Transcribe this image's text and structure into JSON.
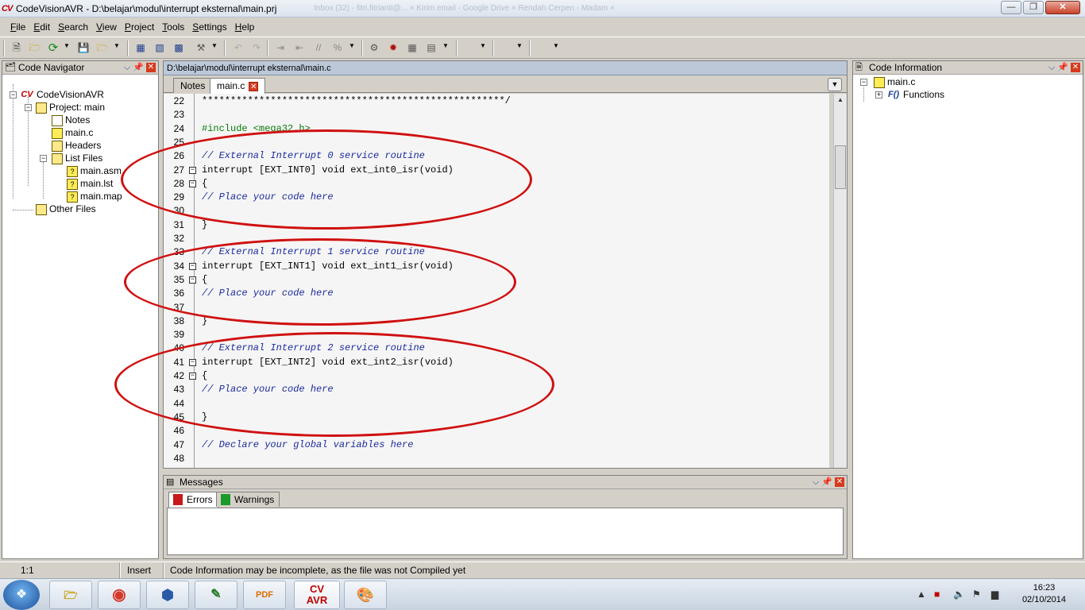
{
  "window": {
    "title": "CodeVisionAVR - D:\\belajar\\modul\\interrupt eksternal\\main.prj",
    "logo": "CV",
    "background_tabs": "Inbox (32) - fitri.fitrianti@...   ×   Kirim email - Google Drive   ×   Rendah Cerpen - Madam   ×"
  },
  "menu": [
    "File",
    "Edit",
    "Search",
    "View",
    "Project",
    "Tools",
    "Settings",
    "Help"
  ],
  "code_navigator": {
    "title": "Code Navigator",
    "root": "CodeVisionAVR",
    "project": "Project: main",
    "items": [
      "Notes",
      "main.c",
      "Headers",
      "List Files"
    ],
    "list_files": [
      "main.asm",
      "main.lst",
      "main.map"
    ],
    "other": "Other Files"
  },
  "editor": {
    "path": "D:\\belajar\\modul\\interrupt eksternal\\main.c",
    "tabs": [
      "Notes",
      "main.c"
    ],
    "lines": [
      {
        "n": "22",
        "t": "*****************************************************/"
      },
      {
        "n": "23",
        "t": ""
      },
      {
        "n": "24",
        "t": "#include <mega32.h>"
      },
      {
        "n": "25",
        "t": ""
      },
      {
        "n": "26",
        "t": "// External Interrupt 0 service routine"
      },
      {
        "n": "27",
        "t": "interrupt [EXT_INT0] void ext_int0_isr(void)"
      },
      {
        "n": "28",
        "t": "{"
      },
      {
        "n": "29",
        "t": "// Place your code here"
      },
      {
        "n": "30",
        "t": ""
      },
      {
        "n": "31",
        "t": "}"
      },
      {
        "n": "32",
        "t": ""
      },
      {
        "n": "33",
        "t": "// External Interrupt 1 service routine"
      },
      {
        "n": "34",
        "t": "interrupt [EXT_INT1] void ext_int1_isr(void)"
      },
      {
        "n": "35",
        "t": "{"
      },
      {
        "n": "36",
        "t": "// Place your code here"
      },
      {
        "n": "37",
        "t": ""
      },
      {
        "n": "38",
        "t": "}"
      },
      {
        "n": "39",
        "t": ""
      },
      {
        "n": "40",
        "t": "// External Interrupt 2 service routine"
      },
      {
        "n": "41",
        "t": "interrupt [EXT_INT2] void ext_int2_isr(void)"
      },
      {
        "n": "42",
        "t": "{"
      },
      {
        "n": "43",
        "t": "// Place your code here"
      },
      {
        "n": "44",
        "t": ""
      },
      {
        "n": "45",
        "t": "}"
      },
      {
        "n": "46",
        "t": ""
      },
      {
        "n": "47",
        "t": "// Declare your global variables here"
      },
      {
        "n": "48",
        "t": ""
      }
    ]
  },
  "messages": {
    "title": "Messages",
    "tabs": [
      "Errors",
      "Warnings"
    ]
  },
  "code_information": {
    "title": "Code Information",
    "file": "main.c",
    "functions": "Functions",
    "fn_icon": "F()"
  },
  "status": {
    "position": "1:1",
    "mode": "Insert",
    "message": "Code Information may be incomplete, as the file was not Compiled yet"
  },
  "taskbar": {
    "apps": [
      "explorer",
      "chrome",
      "virtualbox",
      "notepad",
      "pdf",
      "CV AVR",
      "paint"
    ],
    "cv_label": "CV",
    "cv_label2": "AVR",
    "pdf_label": "PDF",
    "time": "16:23",
    "date": "02/10/2014"
  }
}
